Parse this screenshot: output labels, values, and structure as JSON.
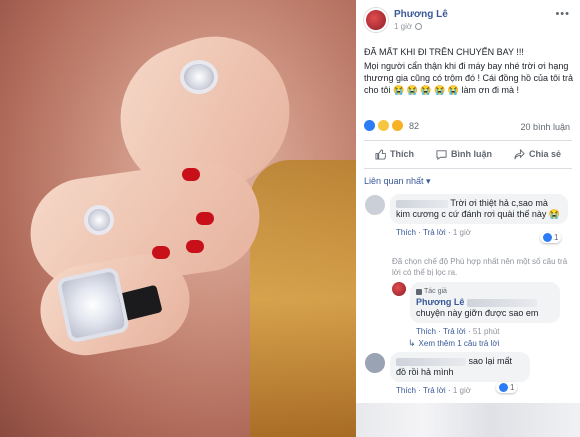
{
  "post": {
    "author": "Phương Lê",
    "time": "1 giờ",
    "title": "ĐÃ MẤT KHI ĐI TRÊN CHUYẾN BAY !!!",
    "body": "Mọi người cẩn thận khi đi máy bay nhé trời ơi hạng thương gia cũng có trộm đó ! Cái đồng hồ của tôi trả cho tôi 😭 😭 😭 😭 😭 làm ơn đi mà !",
    "reaction_count": "82",
    "comment_count": "20 bình luận"
  },
  "actions": {
    "like": "Thích",
    "comment": "Bình luận",
    "share": "Chia sẻ"
  },
  "sort_label": "Liên quan nhất ▾",
  "comments": [
    {
      "text": "Trời ơi thiệt hả c,sao mà kim cương c cứ đánh rơi quài thế này 😭",
      "like": "Thích",
      "reply": "Trả lời",
      "time": "1 giờ",
      "likes": "1"
    },
    {
      "text": "sao lại mất đồ rồi hả mình",
      "like": "Thích",
      "reply": "Trả lời",
      "time": "1 giờ",
      "likes": "1"
    }
  ],
  "notice": "Đã chọn chế độ Phù hợp nhất nên một số câu trả lời có thể bị lọc ra.",
  "author_reply": {
    "tag": "Tác giả",
    "name": "Phương Lê",
    "text": "chuyện này giỡn được sao em",
    "like": "Thích",
    "reply": "Trả lời",
    "time": "51 phút"
  },
  "more_replies": "Xem thêm 1 câu trả lời",
  "colors": {
    "link": "#385898",
    "muted": "#90949c",
    "bubble": "#f2f3f5",
    "like": "#2b7cf6"
  }
}
